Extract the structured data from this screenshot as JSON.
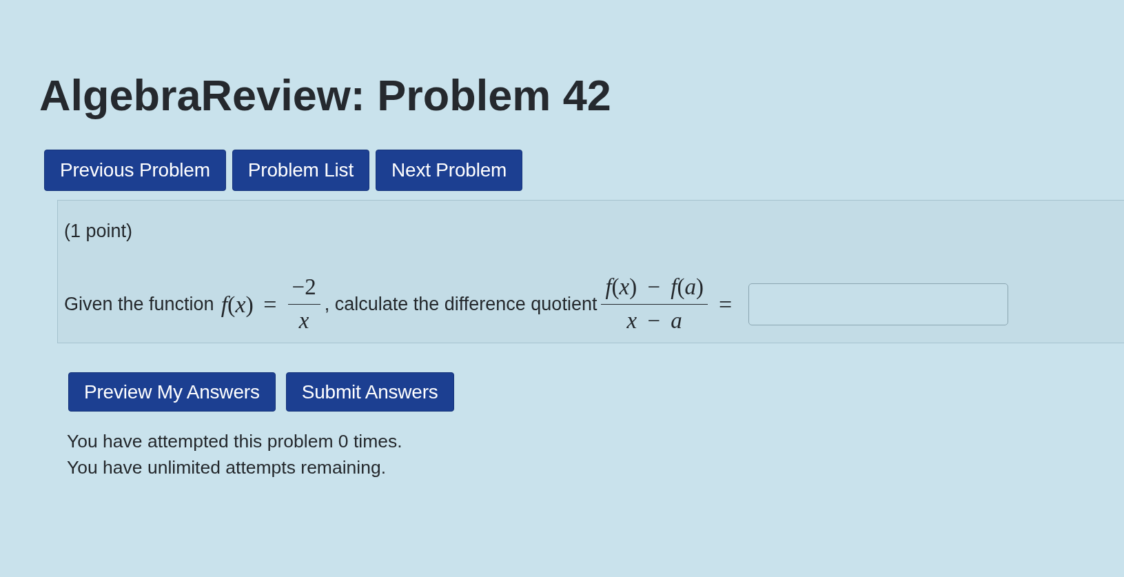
{
  "title": "AlgebraReview: Problem 42",
  "nav_buttons": [
    "Previous Problem",
    "Problem List",
    "Next Problem"
  ],
  "problem": {
    "points": "(1 point)",
    "statement": [
      {
        "kind": "text",
        "text": "Given the function"
      },
      {
        "kind": "math",
        "text": "*f*(*x*) ="
      },
      {
        "kind": "fraction",
        "numerator": "−2",
        "denominator": "*x*"
      },
      {
        "kind": "text",
        "text": ", calculate the difference quotient"
      },
      {
        "kind": "fraction",
        "numerator": "*f*(*x*) − *f*(*a*)",
        "denominator": "*x* − *a*"
      },
      {
        "kind": "math",
        "text": "="
      },
      {
        "kind": "answer"
      }
    ]
  },
  "action_buttons": [
    "Preview My Answers",
    "Submit Answers"
  ],
  "attempts": [
    "You have attempted this problem 0 times.",
    "You have unlimited attempts remaining."
  ]
}
